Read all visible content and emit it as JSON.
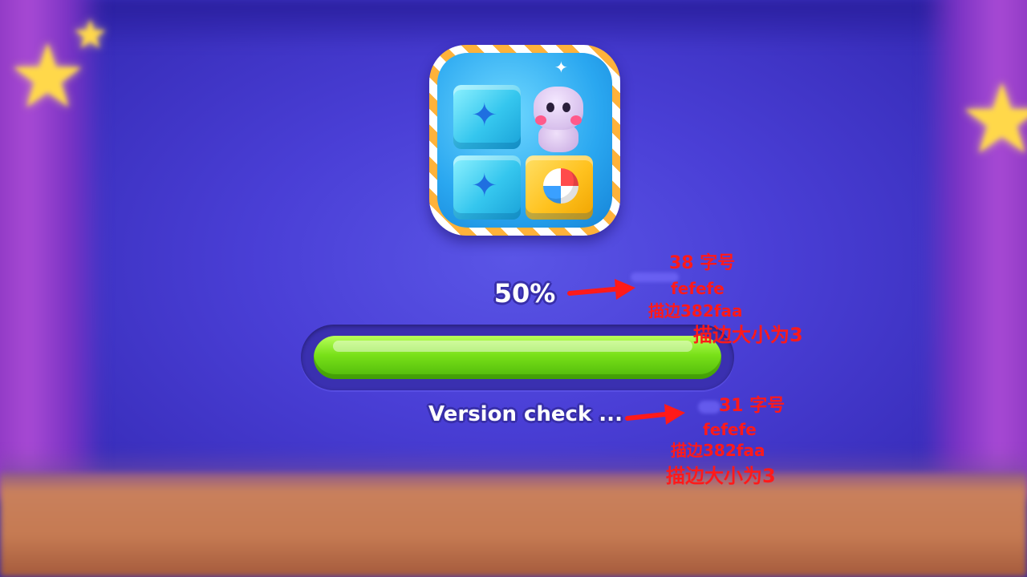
{
  "progress": {
    "percent_text": "50%",
    "percent_value": 100,
    "status_text": "Version check ..."
  },
  "annotations": {
    "percent_note": {
      "size_label": "38 字号",
      "color_label": "fefefe",
      "stroke_color_label": "描边382faa",
      "stroke_size_label": "描边大小为3"
    },
    "status_note": {
      "size_label": "31 字号",
      "color_label": "fefefe",
      "stroke_color_label": "描边382faa",
      "stroke_size_label": "描边大小为3"
    }
  },
  "icons": {
    "app_icon": "hippo-blocks-app-icon",
    "stars": "star-icon"
  },
  "colors": {
    "text_fill": "#fefefe",
    "text_stroke": "#382faa",
    "annotation": "#ff1a1a",
    "progress_fill": "#78e018",
    "progress_track": "#3a30b0"
  }
}
